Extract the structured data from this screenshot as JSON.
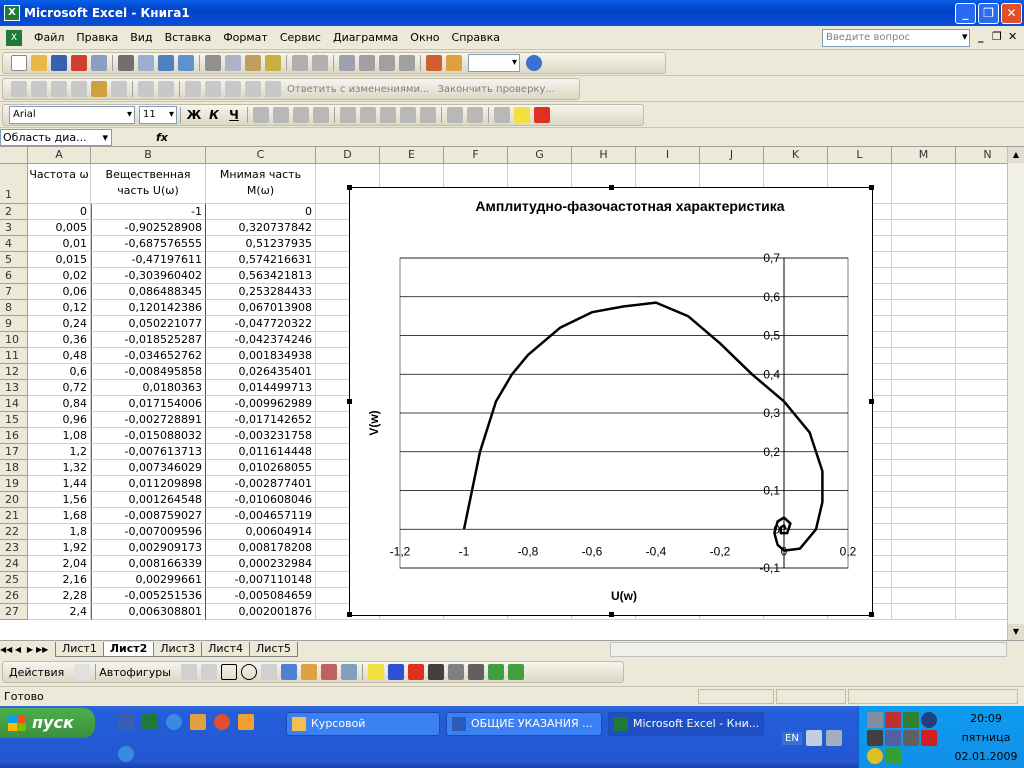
{
  "window": {
    "title": "Microsoft Excel - Книга1"
  },
  "menu": {
    "items": [
      "Файл",
      "Правка",
      "Вид",
      "Вставка",
      "Формат",
      "Сервис",
      "Диаграмма",
      "Окно",
      "Справка"
    ],
    "ask_placeholder": "Введите вопрос"
  },
  "review_toolbar": {
    "reply": "Ответить с изменениями...",
    "end_review": "Закончить проверку..."
  },
  "format_toolbar": {
    "font": "Arial",
    "size": "11",
    "bold": "Ж",
    "italic": "К",
    "underline": "Ч"
  },
  "formula_bar": {
    "name_box": "Область диа...",
    "fx": "fx"
  },
  "grid": {
    "columns": [
      "A",
      "B",
      "C",
      "D",
      "E",
      "F",
      "G",
      "H",
      "I",
      "J",
      "K",
      "L",
      "M",
      "N"
    ],
    "headers": {
      "a": "Частота ω",
      "b": "Вещественная часть U(ω)",
      "c": "Мнимая часть M(ω)"
    },
    "rows": [
      {
        "n": "2",
        "a": "0",
        "b": "-1",
        "c": "0"
      },
      {
        "n": "3",
        "a": "0,005",
        "b": "-0,902528908",
        "c": "0,320737842"
      },
      {
        "n": "4",
        "a": "0,01",
        "b": "-0,687576555",
        "c": "0,51237935"
      },
      {
        "n": "5",
        "a": "0,015",
        "b": "-0,47197611",
        "c": "0,574216631"
      },
      {
        "n": "6",
        "a": "0,02",
        "b": "-0,303960402",
        "c": "0,563421813"
      },
      {
        "n": "7",
        "a": "0,06",
        "b": "0,086488345",
        "c": "0,253284433"
      },
      {
        "n": "8",
        "a": "0,12",
        "b": "0,120142386",
        "c": "0,067013908"
      },
      {
        "n": "9",
        "a": "0,24",
        "b": "0,050221077",
        "c": "-0,047720322"
      },
      {
        "n": "10",
        "a": "0,36",
        "b": "-0,018525287",
        "c": "-0,042374246"
      },
      {
        "n": "11",
        "a": "0,48",
        "b": "-0,034652762",
        "c": "0,001834938"
      },
      {
        "n": "12",
        "a": "0,6",
        "b": "-0,008495858",
        "c": "0,026435401"
      },
      {
        "n": "13",
        "a": "0,72",
        "b": "0,0180363",
        "c": "0,014499713"
      },
      {
        "n": "14",
        "a": "0,84",
        "b": "0,017154006",
        "c": "-0,009962989"
      },
      {
        "n": "15",
        "a": "0,96",
        "b": "-0,002728891",
        "c": "-0,017142652"
      },
      {
        "n": "16",
        "a": "1,08",
        "b": "-0,015088032",
        "c": "-0,003231758"
      },
      {
        "n": "17",
        "a": "1,2",
        "b": "-0,007613713",
        "c": "0,011614448"
      },
      {
        "n": "18",
        "a": "1,32",
        "b": "0,007346029",
        "c": "0,010268055"
      },
      {
        "n": "19",
        "a": "1,44",
        "b": "0,011209898",
        "c": "-0,002877401"
      },
      {
        "n": "20",
        "a": "1,56",
        "b": "0,001264548",
        "c": "-0,010608046"
      },
      {
        "n": "21",
        "a": "1,68",
        "b": "-0,008759027",
        "c": "-0,004657119"
      },
      {
        "n": "22",
        "a": "1,8",
        "b": "-0,007009596",
        "c": "0,00604914"
      },
      {
        "n": "23",
        "a": "1,92",
        "b": "0,002909173",
        "c": "0,008178208"
      },
      {
        "n": "24",
        "a": "2,04",
        "b": "0,008166339",
        "c": "0,000232984"
      },
      {
        "n": "25",
        "a": "2,16",
        "b": "0,00299661",
        "c": "-0,007110148"
      },
      {
        "n": "26",
        "a": "2,28",
        "b": "-0,005251536",
        "c": "-0,005084659"
      },
      {
        "n": "27",
        "a": "2,4",
        "b": "0,006308801",
        "c": "0,002001876"
      }
    ]
  },
  "chart_data": {
    "type": "line",
    "title": "Амплитудно-фазочастотная характеристика",
    "xlabel": "U(w)",
    "ylabel": "V(w)",
    "xlim": [
      -1.2,
      0.2
    ],
    "ylim": [
      -0.1,
      0.7
    ],
    "x_ticks": [
      "-1,2",
      "-1",
      "-0,8",
      "-0,6",
      "-0,4",
      "-0,2",
      "0",
      "0,2"
    ],
    "y_ticks": [
      "-0,1",
      "0",
      "0,1",
      "0,2",
      "0,3",
      "0,4",
      "0,5",
      "0,6",
      "0,7"
    ],
    "grid": "horizontal",
    "series": [
      {
        "x": [
          -1,
          -0.95,
          -0.9,
          -0.85,
          -0.8,
          -0.7,
          -0.6,
          -0.5,
          -0.4,
          -0.3,
          -0.2,
          -0.1,
          0,
          0.08,
          0.12,
          0.12,
          0.1,
          0.05,
          0,
          -0.02,
          -0.03,
          -0.02,
          0,
          0.02,
          0.01,
          -0.01,
          -0.01,
          0,
          0.005
        ],
        "y": [
          0,
          0.2,
          0.33,
          0.4,
          0.45,
          0.52,
          0.56,
          0.575,
          0.585,
          0.55,
          0.48,
          0.4,
          0.33,
          0.25,
          0.15,
          0.07,
          0,
          -0.05,
          -0.055,
          -0.04,
          -0.01,
          0.02,
          0.03,
          0.015,
          -0.01,
          -0.01,
          0.005,
          0.01,
          0
        ]
      }
    ]
  },
  "sheet_tabs": [
    "Лист1",
    "Лист2",
    "Лист3",
    "Лист4",
    "Лист5"
  ],
  "active_tab": "Лист2",
  "drawing": {
    "actions": "Действия",
    "autoshapes": "Автофигуры"
  },
  "status": {
    "text": "Готово"
  },
  "taskbar": {
    "start": "пуск",
    "tasks": [
      "Курсовой",
      "ОБЩИЕ УКАЗАНИЯ ...",
      "Microsoft Excel - Кни..."
    ],
    "lang": "EN",
    "time": "20:09",
    "day": "пятница",
    "date": "02.01.2009"
  },
  "colors": {
    "xp_blue": "#0a5fe8",
    "excel_green": "#1d7a3a",
    "start_green": "#3c8f3c"
  }
}
